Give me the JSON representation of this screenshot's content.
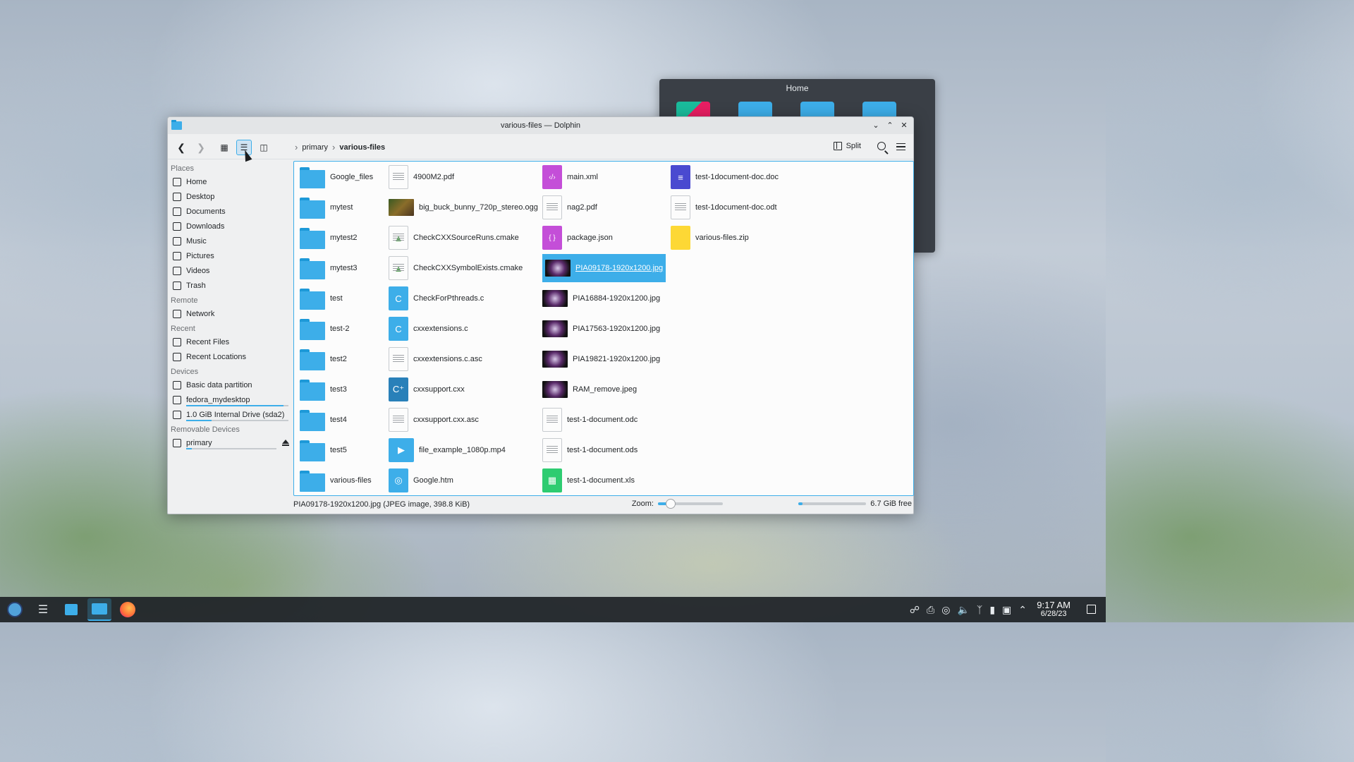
{
  "background_window": {
    "title": "Home"
  },
  "window": {
    "title": "various-files — Dolphin"
  },
  "toolbar": {
    "breadcrumb": [
      "primary",
      "various-files"
    ],
    "split_label": "Split"
  },
  "sidebar": {
    "sections": [
      {
        "title": "Places",
        "items": [
          {
            "label": "Home",
            "icon": "home-icon"
          },
          {
            "label": "Desktop",
            "icon": "desktop-icon"
          },
          {
            "label": "Documents",
            "icon": "documents-icon"
          },
          {
            "label": "Downloads",
            "icon": "downloads-icon"
          },
          {
            "label": "Music",
            "icon": "music-icon"
          },
          {
            "label": "Pictures",
            "icon": "pictures-icon"
          },
          {
            "label": "Videos",
            "icon": "videos-icon"
          },
          {
            "label": "Trash",
            "icon": "trash-icon"
          }
        ]
      },
      {
        "title": "Remote",
        "items": [
          {
            "label": "Network",
            "icon": "network-icon"
          }
        ]
      },
      {
        "title": "Recent",
        "items": [
          {
            "label": "Recent Files",
            "icon": "recent-files-icon"
          },
          {
            "label": "Recent Locations",
            "icon": "recent-locations-icon"
          }
        ]
      },
      {
        "title": "Devices",
        "items": [
          {
            "label": "Basic data partition",
            "icon": "drive-icon"
          },
          {
            "label": "fedora_mydesktop",
            "icon": "drive-icon",
            "usage": 0.95
          },
          {
            "label": "1.0 GiB Internal Drive (sda2)",
            "icon": "drive-icon",
            "usage": 0.25
          }
        ]
      },
      {
        "title": "Removable Devices",
        "items": [
          {
            "label": "primary",
            "icon": "usb-drive-icon",
            "usage": 0.06,
            "eject": true
          }
        ]
      }
    ]
  },
  "files": {
    "columns": [
      [
        {
          "name": "Google_files",
          "type": "folder"
        },
        {
          "name": "mytest",
          "type": "folder"
        },
        {
          "name": "mytest2",
          "type": "folder"
        },
        {
          "name": "mytest3",
          "type": "folder"
        },
        {
          "name": "test",
          "type": "folder"
        },
        {
          "name": "test-2",
          "type": "folder"
        },
        {
          "name": "test2",
          "type": "folder"
        },
        {
          "name": "test3",
          "type": "folder"
        },
        {
          "name": "test4",
          "type": "folder"
        },
        {
          "name": "test5",
          "type": "folder"
        },
        {
          "name": "various-files",
          "type": "folder"
        }
      ],
      [
        {
          "name": "4900M2.pdf",
          "type": "pdf"
        },
        {
          "name": "big_buck_bunny_720p_stereo.ogg",
          "type": "video-thumb"
        },
        {
          "name": "CheckCXXSourceRuns.cmake",
          "type": "cmake"
        },
        {
          "name": "CheckCXXSymbolExists.cmake",
          "type": "cmake"
        },
        {
          "name": "CheckForPthreads.c",
          "type": "c-source"
        },
        {
          "name": "cxxextensions.c",
          "type": "c-source"
        },
        {
          "name": "cxxextensions.c.asc",
          "type": "text"
        },
        {
          "name": "cxxsupport.cxx",
          "type": "cxx-source"
        },
        {
          "name": "cxxsupport.cxx.asc",
          "type": "text"
        },
        {
          "name": "file_example_1080p.mp4",
          "type": "video"
        },
        {
          "name": "Google.htm",
          "type": "html"
        }
      ],
      [
        {
          "name": "main.xml",
          "type": "xml"
        },
        {
          "name": "nag2.pdf",
          "type": "pdf-blank"
        },
        {
          "name": "package.json",
          "type": "json"
        },
        {
          "name": "PIA09178-1920x1200.jpg",
          "type": "image-thumb",
          "selected": true
        },
        {
          "name": "PIA16884-1920x1200.jpg",
          "type": "image-thumb"
        },
        {
          "name": "PIA17563-1920x1200.jpg",
          "type": "image-thumb"
        },
        {
          "name": "PIA19821-1920x1200.jpg",
          "type": "image-thumb"
        },
        {
          "name": "RAM_remove.jpeg",
          "type": "image-thumb"
        },
        {
          "name": "test-1-document.odc",
          "type": "document"
        },
        {
          "name": "test-1-document.ods",
          "type": "document"
        },
        {
          "name": "test-1-document.xls",
          "type": "spreadsheet"
        }
      ],
      [
        {
          "name": "test-1document-doc.doc",
          "type": "word"
        },
        {
          "name": "test-1document-doc.odt",
          "type": "document"
        },
        {
          "name": "various-files.zip",
          "type": "zip"
        }
      ]
    ]
  },
  "statusbar": {
    "selection_text": "PIA09178-1920x1200.jpg (JPEG image, 398.8 KiB)",
    "zoom_label": "Zoom:",
    "zoom_level": 0.2,
    "free_space_text": "6.7 GiB free",
    "space_used": 0.06
  },
  "taskbar": {
    "time": "9:17 AM",
    "date": "6/28/23"
  },
  "colors": {
    "accent": "#3daee9",
    "selection_bg": "#3daee9",
    "taskbar_bg": "#202428"
  }
}
